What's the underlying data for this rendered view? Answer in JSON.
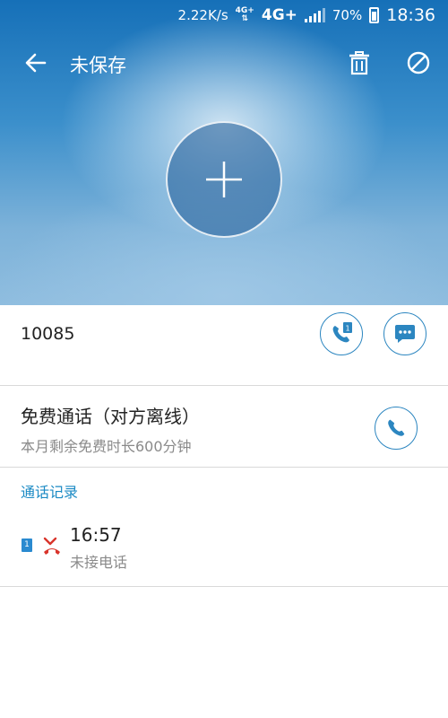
{
  "status_bar": {
    "speed": "2.22K/s",
    "network_small": "4G+",
    "network": "4G+",
    "battery": "70%",
    "time": "18:36"
  },
  "toolbar": {
    "title": "未保存",
    "back_icon": "arrow-left-icon",
    "delete_icon": "trash-icon",
    "block_icon": "block-icon"
  },
  "avatar": {
    "icon": "plus-icon"
  },
  "contact": {
    "number": "10085",
    "sim_label": "1"
  },
  "free_call": {
    "title": "免费通话（对方离线）",
    "subtitle": "本月剩余免费时长600分钟"
  },
  "call_log": {
    "header": "通话记录",
    "entries": [
      {
        "sim": "1",
        "time": "16:57",
        "status": "未接电话"
      }
    ]
  },
  "colors": {
    "accent": "#1b8ac4",
    "missed": "#d9342b",
    "hero_top": "#1670b8"
  }
}
